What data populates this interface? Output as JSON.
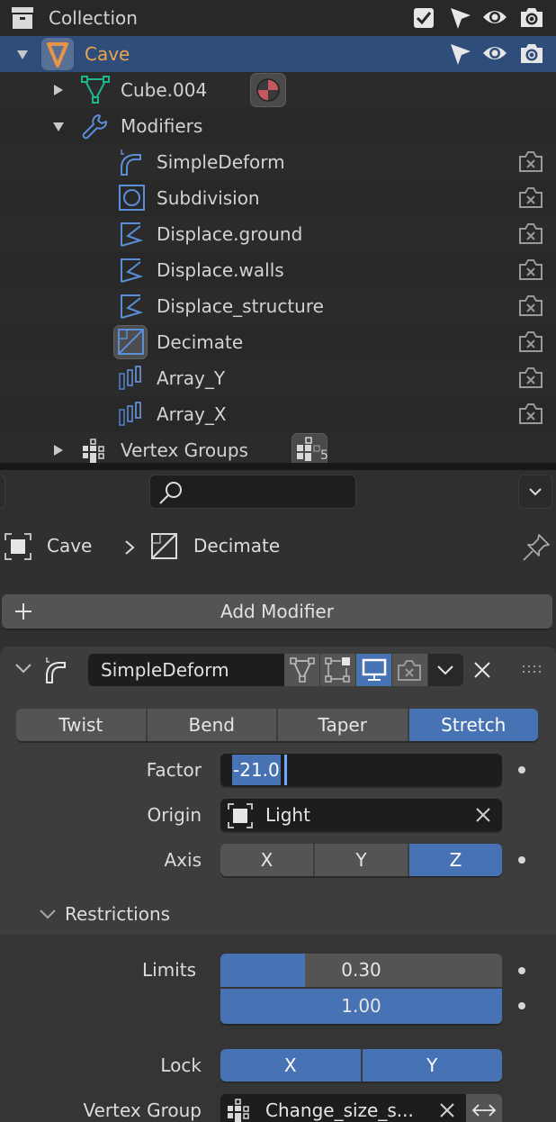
{
  "outliner": {
    "collection": {
      "label": "Collection",
      "icons": [
        "checkbox-icon",
        "select-arrow-icon",
        "eye-icon",
        "camera-icon"
      ]
    },
    "object": {
      "label": "Cave",
      "selected": true,
      "expanded": true
    },
    "mesh": {
      "label": "Cube.004",
      "expanded": false
    },
    "modifiers_group": {
      "label": "Modifiers",
      "expanded": true
    },
    "modifiers": [
      {
        "label": "SimpleDeform",
        "icon": "simple-deform-icon"
      },
      {
        "label": "Subdivision",
        "icon": "subdivision-icon"
      },
      {
        "label": "Displace.ground",
        "icon": "displace-icon"
      },
      {
        "label": "Displace.walls",
        "icon": "displace-icon"
      },
      {
        "label": "Displace_structure",
        "icon": "displace-icon"
      },
      {
        "label": "Decimate",
        "icon": "decimate-icon",
        "active": true
      },
      {
        "label": "Array_Y",
        "icon": "array-icon"
      },
      {
        "label": "Array_X",
        "icon": "array-icon"
      }
    ],
    "vertex_groups": {
      "label": "Vertex Groups",
      "count": "5",
      "expanded": false
    }
  },
  "properties": {
    "search": {
      "placeholder": "",
      "value": ""
    },
    "breadcrumb": {
      "object": "Cave",
      "modifier": "Decimate"
    },
    "add_modifier_label": "Add Modifier",
    "modifier_panel": {
      "name": "SimpleDeform",
      "toggles": {
        "edit_mode": false,
        "cage": false,
        "viewport": true,
        "render": false
      },
      "modes": [
        "Twist",
        "Bend",
        "Taper",
        "Stretch"
      ],
      "active_mode": "Stretch",
      "factor_label": "Factor",
      "factor_value": "-21.0",
      "origin_label": "Origin",
      "origin_value": "Light",
      "axis_label": "Axis",
      "axes": [
        "X",
        "Y",
        "Z"
      ],
      "active_axis": "Z",
      "restrictions": {
        "label": "Restrictions",
        "limits_label": "Limits",
        "limit_min": "0.30",
        "limit_min_fraction": 0.3,
        "limit_max": "1.00",
        "limit_max_fraction": 1.0,
        "lock_label": "Lock",
        "lock_axes": [
          "X",
          "Y"
        ],
        "lock_active": [
          true,
          true
        ],
        "vertex_group_label": "Vertex Group",
        "vertex_group_value": "Change_size_s..."
      }
    }
  },
  "colors": {
    "accent": "#4772b3",
    "selected_row": "#2f4d7b",
    "object_name": "#f0a44c",
    "modifier_icon": "#5b8ed8"
  }
}
